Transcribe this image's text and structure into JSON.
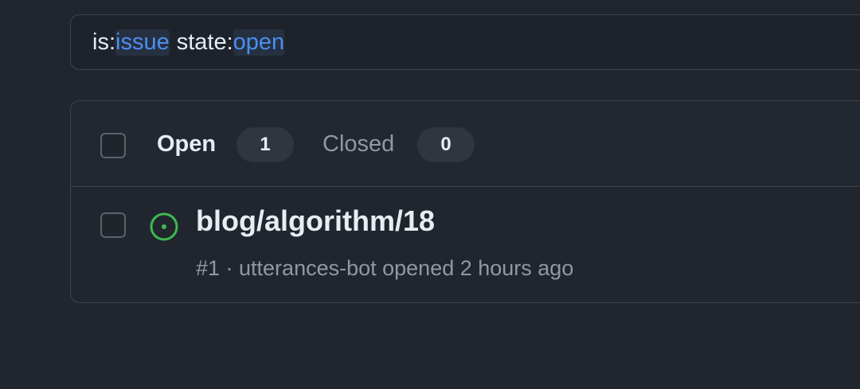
{
  "search": {
    "token1_key": "is:",
    "token1_value": "issue",
    "token2_key": "state:",
    "token2_value": "open"
  },
  "filters": {
    "open_label": "Open",
    "open_count": "1",
    "closed_label": "Closed",
    "closed_count": "0"
  },
  "issues": [
    {
      "title": "blog/algorithm/18",
      "meta": "#1 · utterances-bot opened 2 hours ago",
      "status_icon": "issue-opened-icon"
    }
  ],
  "colors": {
    "background": "#21262e",
    "accent_blue": "#4c8ef0",
    "open_green": "#3fb950",
    "muted_text": "#9198a1"
  }
}
